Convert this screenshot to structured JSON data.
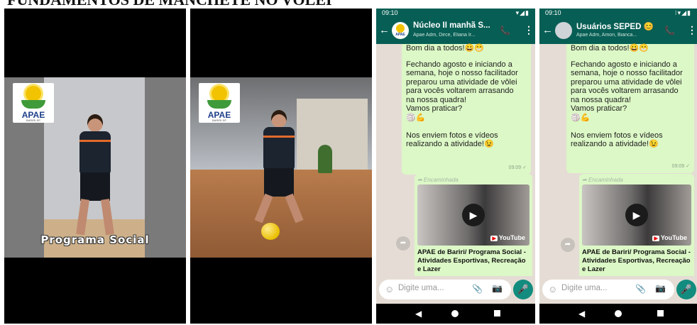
{
  "page": {
    "title": "FUNDAMENTOS DE MANCHETE NO VÔLEI"
  },
  "video_frames": [
    {
      "logo": {
        "name": "APAE",
        "subtitle": "BARIRI-SP"
      },
      "caption": "Programa Social"
    },
    {
      "logo": {
        "name": "APAE",
        "subtitle": "BARIRI-SP"
      }
    }
  ],
  "chats": [
    {
      "status_time": "09:10",
      "status_icons": "▾◢▮",
      "name": "Núcleo II manhã S...",
      "members": "Apae Adm, Dirce, Eliana Ir...",
      "avatar_text": "APAE",
      "message_partial": "Bom dia a todos!😀😁",
      "message_main": "Fechando agosto e iniciando a\nsemana, hoje o nosso facilitador\npreparou uma atividade de vôlei\npara vocês voltarem arrasando\nna nossa quadra!\nVamos praticar?\n🏐💪\n\nNos enviem fotos e vídeos\nrealizando a atividade!😉",
      "message_time": "09:09 ✓",
      "forward_label": "➦ Encaminhada",
      "youtube_label": "YouTube",
      "link_title": "APAE de Bariri/ Programa Social - Atividades Esportivas, Recreação e Lazer",
      "input_placeholder": "Digite uma..."
    },
    {
      "status_time": "09:10",
      "status_icons": "⁝▾◢▮",
      "name": "Usuários SEPED 😊",
      "members": "Apae Adm, Amon, Bianca...",
      "avatar_text": "",
      "message_partial": "Bom dia a todos!😀😁",
      "message_main": "Fechando agosto e iniciando a\nsemana, hoje o nosso facilitador\npreparou uma atividade de vôlei\npara vocês voltarem arrasando\nna nossa quadra!\nVamos praticar?\n🏐💪\n\nNos enviem fotos e vídeos\nrealizando a atividade!😉",
      "message_time": "09:09 ✓",
      "forward_label": "➦ Encaminhada",
      "youtube_label": "YouTube",
      "link_title": "APAE de Bariri/ Programa Social - Atividades Esportivas, Recreação e Lazer",
      "input_placeholder": "Digite uma..."
    }
  ],
  "colors": {
    "header": "#075e54",
    "bubble": "#dcf8c6",
    "chat_bg": "#e5ddd5",
    "mic": "#128c7e"
  }
}
